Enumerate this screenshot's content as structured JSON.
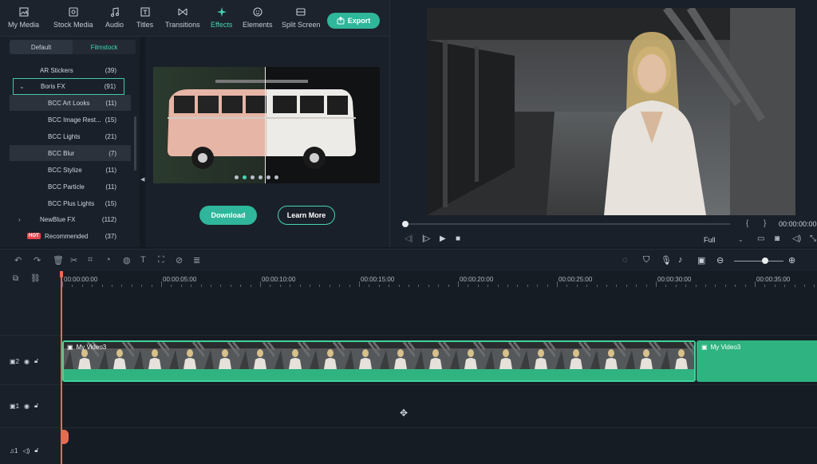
{
  "toolbar": {
    "items": [
      {
        "label": "My Media",
        "icon": "media-icon"
      },
      {
        "label": "Stock Media",
        "icon": "stock-icon"
      },
      {
        "label": "Audio",
        "icon": "music-icon"
      },
      {
        "label": "Titles",
        "icon": "title-icon"
      },
      {
        "label": "Transitions",
        "icon": "transition-icon"
      },
      {
        "label": "Effects",
        "icon": "effects-icon"
      },
      {
        "label": "Elements",
        "icon": "elements-icon"
      },
      {
        "label": "Split Screen",
        "icon": "split-screen-icon"
      }
    ],
    "active": "Effects",
    "export_label": "Export"
  },
  "subtabs": {
    "default": "Default",
    "filmstock": "Filmstock"
  },
  "effects_list": [
    {
      "label": "AR Stickers",
      "count": "(39)"
    },
    {
      "label": "Boris FX",
      "count": "(91)"
    },
    {
      "label": "BCC Art Looks",
      "count": "(11)"
    },
    {
      "label": "BCC Image Rest...",
      "count": "(15)"
    },
    {
      "label": "BCC Lights",
      "count": "(21)"
    },
    {
      "label": "BCC Blur",
      "count": "(7)"
    },
    {
      "label": "BCC Stylize",
      "count": "(11)"
    },
    {
      "label": "BCC Particle",
      "count": "(11)"
    },
    {
      "label": "BCC Plus Lights",
      "count": "(15)"
    },
    {
      "label": "NewBlue FX",
      "count": "(112)"
    },
    {
      "label": "Recommended",
      "count": "(37)",
      "badge": "HOT"
    }
  ],
  "preview": {
    "download_label": "Download",
    "learn_label": "Learn More",
    "page_count": 6,
    "active_page": 1
  },
  "player": {
    "timecode": "00:00:00:00",
    "quality": "Full",
    "progress": 0
  },
  "ruler": [
    "00:00:00:00",
    "00:00:05:00",
    "00:00:10:00",
    "00:00:15:00",
    "00:00:20:00",
    "00:00:25:00",
    "00:00:30:00",
    "00:00:35:00"
  ],
  "tracks": [
    {
      "label": "2"
    },
    {
      "label": "1"
    },
    {
      "label": "1"
    }
  ],
  "clips": [
    {
      "label": "My Video3"
    },
    {
      "label": "My Video3"
    }
  ],
  "colors": {
    "accent": "#2fb69b",
    "clip": "#2fb380",
    "playhead": "#e96a52",
    "hot": "#e5484d"
  }
}
